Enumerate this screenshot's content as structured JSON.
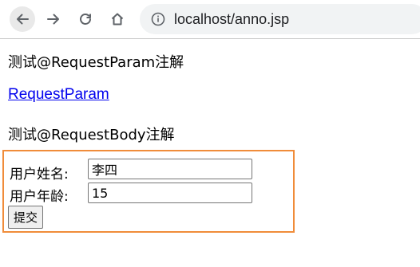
{
  "browser": {
    "url": "localhost/anno.jsp",
    "icons": [
      "back-icon",
      "forward-icon",
      "reload-icon",
      "home-icon",
      "info-icon"
    ]
  },
  "page": {
    "heading_request_param": "测试@RequestParam注解",
    "link_request_param": "RequestParam",
    "heading_request_body": "测试@RequestBody注解",
    "form": {
      "name_label": "用户姓名:",
      "name_value": "李四",
      "age_label": "用户年龄:",
      "age_value": "15",
      "submit_label": "提交",
      "border_color": "#f08c3a"
    }
  }
}
